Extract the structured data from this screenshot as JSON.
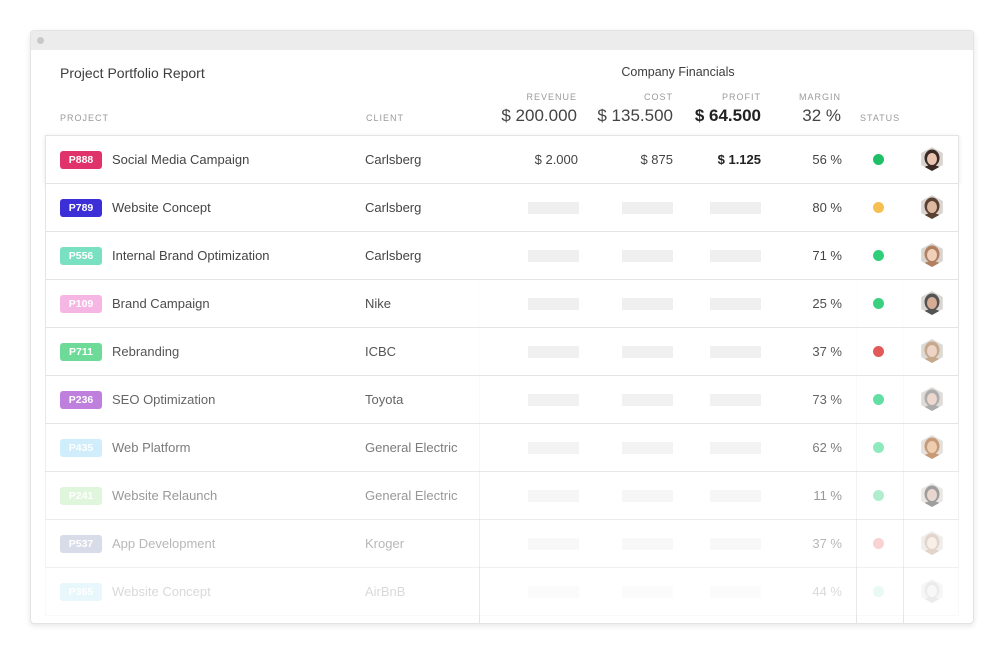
{
  "report": {
    "title": "Project Portfolio Report"
  },
  "financials": {
    "title": "Company Financials",
    "columns": {
      "project": "PROJECT",
      "client": "CLIENT",
      "revenue": "REVENUE",
      "cost": "COST",
      "profit": "PROFIT",
      "margin": "MARGIN",
      "status": "STATUS"
    },
    "totals": {
      "revenue": "$ 200.000",
      "cost": "$ 135.500",
      "profit": "$ 64.500",
      "margin": "32 %"
    }
  },
  "rows": [
    {
      "code": "P888",
      "badge_color": "#e0336b",
      "name": "Social Media Campaign",
      "client": "Carlsberg",
      "revenue": "$ 2.000",
      "cost": "$ 875",
      "profit": "$ 1.125",
      "margin": "56 %",
      "status_color": "#1fbf68",
      "opacity": 1.0,
      "avatar": "woman-dark-hair-avatar-icon",
      "avatar_colors": [
        "#3a2a25",
        "#e8c4b0"
      ]
    },
    {
      "code": "P789",
      "badge_color": "#3d2fd8",
      "name": "Website Concept",
      "client": "Carlsberg",
      "revenue": "",
      "cost": "",
      "profit": "",
      "margin": "80 %",
      "status_color": "#f5c050",
      "opacity": 1.0,
      "avatar": "woman-brown-hair-avatar-icon",
      "avatar_colors": [
        "#5a4030",
        "#ddb8a0"
      ]
    },
    {
      "code": "P556",
      "badge_color": "#7ae0c2",
      "name": "Internal Brand Optimization",
      "client": "Carlsberg",
      "revenue": "",
      "cost": "",
      "profit": "",
      "margin": "71 %",
      "status_color": "#2fcf7a",
      "opacity": 1.0,
      "avatar": "woman-blonde-avatar-icon",
      "avatar_colors": [
        "#b08060",
        "#f0d0b8"
      ]
    },
    {
      "code": "P109",
      "badge_color": "#f6b3e3",
      "name": "Brand Campaign",
      "client": "Nike",
      "revenue": "",
      "cost": "",
      "profit": "",
      "margin": "25 %",
      "status_color": "#2fcf7a",
      "opacity": 0.95,
      "avatar": "man-short-hair-avatar-icon",
      "avatar_colors": [
        "#4a4a4a",
        "#d4a890"
      ]
    },
    {
      "code": "P711",
      "badge_color": "#5ed88c",
      "name": "Rebranding",
      "client": "ICBC",
      "revenue": "",
      "cost": "",
      "profit": "",
      "margin": "37 %",
      "status_color": "#e04848",
      "opacity": 0.9,
      "avatar": "woman-light-hair-avatar-icon",
      "avatar_colors": [
        "#c0a080",
        "#ecd0c0"
      ]
    },
    {
      "code": "P236",
      "badge_color": "#b063d6",
      "name": "SEO Optimization",
      "client": "Toyota",
      "revenue": "",
      "cost": "",
      "profit": "",
      "margin": "73 %",
      "status_color": "#40d890",
      "opacity": 0.82,
      "avatar": "man-grey-hair-avatar-icon",
      "avatar_colors": [
        "#9a9a9a",
        "#e8d0c4"
      ]
    },
    {
      "code": "P435",
      "badge_color": "#bde6fb",
      "name": "Web Platform",
      "client": "General Electric",
      "revenue": "",
      "cost": "",
      "profit": "",
      "margin": "62 %",
      "status_color": "#5fe0a0",
      "opacity": 0.7,
      "avatar": "man-beard-avatar-icon",
      "avatar_colors": [
        "#b07040",
        "#e8b890"
      ]
    },
    {
      "code": "P241",
      "badge_color": "#c8efc0",
      "name": "Website Relaunch",
      "client": "General Electric",
      "revenue": "",
      "cost": "",
      "profit": "",
      "margin": "11 %",
      "status_color": "#70e0a8",
      "opacity": 0.55,
      "avatar": "man-dark-hair-avatar-icon",
      "avatar_colors": [
        "#505050",
        "#d8b8a8"
      ]
    },
    {
      "code": "P537",
      "badge_color": "#9aa6c4",
      "name": "App Development",
      "client": "Kroger",
      "revenue": "",
      "cost": "",
      "profit": "",
      "margin": "37 %",
      "status_color": "#f08a8a",
      "opacity": 0.38,
      "avatar": "woman-avatar-icon",
      "avatar_colors": [
        "#b89078",
        "#f0d6c6"
      ]
    },
    {
      "code": "P365",
      "badge_color": "#90dcf0",
      "name": "Website Concept",
      "client": "AirBnB",
      "revenue": "",
      "cost": "",
      "profit": "",
      "margin": "44 %",
      "status_color": "#8ee8c8",
      "opacity": 0.2,
      "avatar": "person-avatar-icon",
      "avatar_colors": [
        "#a0a0a0",
        "#e0e0e0"
      ]
    }
  ]
}
